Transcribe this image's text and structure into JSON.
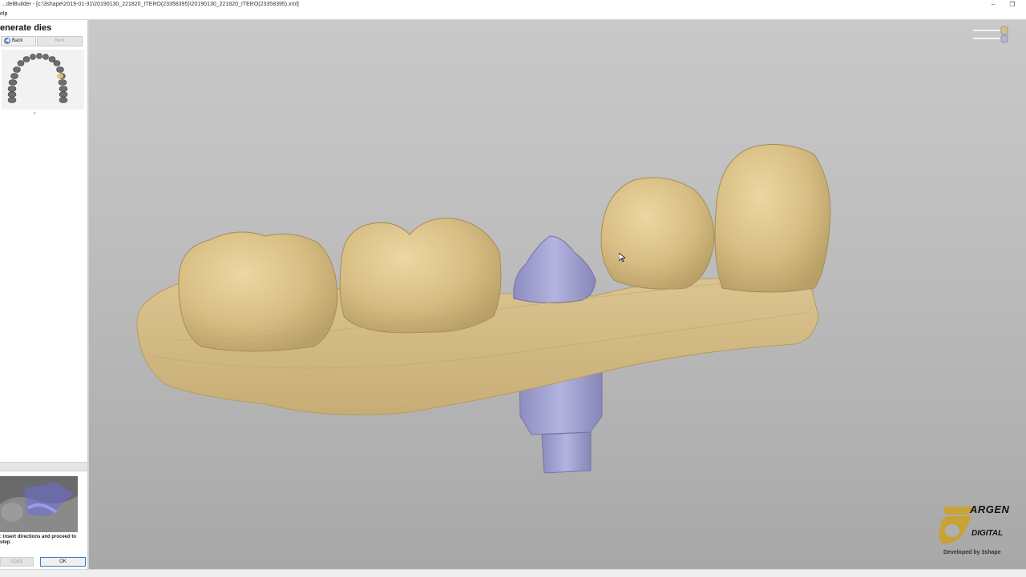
{
  "window": {
    "title": "...delBuilder - [c:\\3shape\\2019-01-31\\20190130_221820_ITERO(23358395)\\20190130_221820_ITERO(23358395).xml]",
    "minimize_icon": "minimize-icon",
    "restore_icon": "restore-icon"
  },
  "menubar": {
    "items": [
      {
        "label": "elp"
      }
    ]
  },
  "sidebar": {
    "step_title": "enerate dies",
    "back_label": "Back",
    "next_label": "Next",
    "help_text": ": insert directions and proceed to step.",
    "apply_label": "Apply",
    "ok_label": "OK"
  },
  "viewport": {
    "background_top": "#c9c9c9",
    "background_bottom": "#a8a8a8",
    "model_color": "#d8c08a",
    "die_color": "#a8a8d8"
  },
  "logo": {
    "brand": "ARGEN",
    "sub": "DIGITAL",
    "developed_by": "Developed by 3shape",
    "accent": "#c9a235"
  }
}
